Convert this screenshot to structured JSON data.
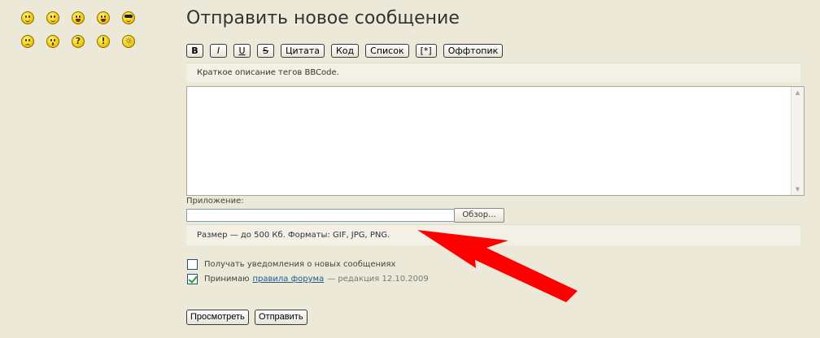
{
  "smileys": [
    [
      "smile",
      "happy",
      "grin",
      "laugh",
      "cool"
    ],
    [
      "sad",
      "surprised",
      "question",
      "exclaim",
      "idea"
    ]
  ],
  "form": {
    "title": "Отправить новое сообщение",
    "bbcode_buttons": [
      "B",
      "I",
      "U",
      "S",
      "Цитата",
      "Код",
      "Список",
      "[*]",
      "Оффтопик"
    ],
    "bbcode_hint": "Краткое описание тегов BBCode.",
    "attachment_label": "Приложение:",
    "browse_label": "Обзор...",
    "attachment_hint": "Размер — до 500 Кб. Форматы: GIF, JPG, PNG.",
    "notify_label": "Получать уведомления о новых сообщениях",
    "accept_label": "Принимаю",
    "rules_link": "правила форума",
    "rules_edition": "— редакция 12.10.2009",
    "preview_label": "Просмотреть",
    "submit_label": "Отправить",
    "notify_checked": false,
    "accept_checked": true
  },
  "colors": {
    "arrow": "#ff0000",
    "background": "#ece9d8"
  }
}
